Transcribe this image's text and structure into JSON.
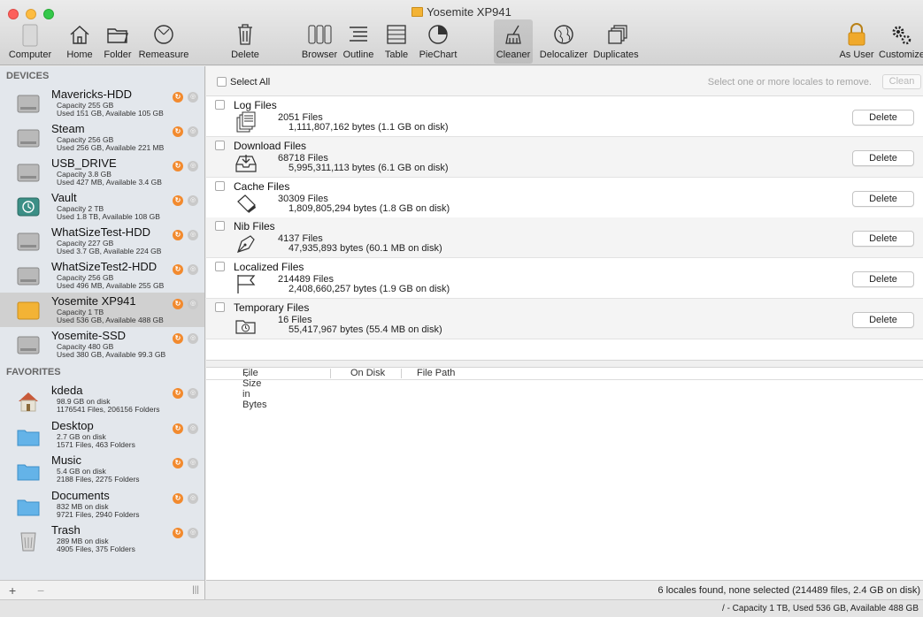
{
  "window": {
    "title": "Yosemite XP941"
  },
  "toolbar": [
    {
      "label": "Computer",
      "icon": "computer-icon"
    },
    {
      "label": "Home",
      "icon": "home-icon"
    },
    {
      "label": "Folder",
      "icon": "folder-icon"
    },
    {
      "label": "Remeasure",
      "icon": "remeasure-icon"
    },
    {
      "label": "Delete",
      "icon": "trash-icon"
    },
    {
      "label": "Browser",
      "icon": "browser-icon"
    },
    {
      "label": "Outline",
      "icon": "outline-icon"
    },
    {
      "label": "Table",
      "icon": "table-icon"
    },
    {
      "label": "PieChart",
      "icon": "piechart-icon"
    },
    {
      "label": "Cleaner",
      "icon": "broom-icon"
    },
    {
      "label": "Delocalizer",
      "icon": "globe-icon"
    },
    {
      "label": "Duplicates",
      "icon": "duplicates-icon"
    },
    {
      "label": "As User",
      "icon": "lock-icon"
    },
    {
      "label": "Customize",
      "icon": "gears-icon"
    }
  ],
  "sidebar": {
    "devices_header": "DEVICES",
    "favorites_header": "FAVORITES",
    "devices": [
      {
        "name": "Mavericks-HDD",
        "line1": "Capacity 255 GB",
        "line2": "Used 151 GB, Available 105 GB",
        "kind": "hdd"
      },
      {
        "name": "Steam",
        "line1": "Capacity 256 GB",
        "line2": "Used 256 GB, Available 221 MB",
        "kind": "hdd"
      },
      {
        "name": "USB_DRIVE",
        "line1": "Capacity 3.8 GB",
        "line2": "Used 427 MB, Available 3.4 GB",
        "kind": "hdd"
      },
      {
        "name": "Vault",
        "line1": "Capacity 2 TB",
        "line2": "Used 1.8 TB, Available 108 GB",
        "kind": "timemachine"
      },
      {
        "name": "WhatSizeTest-HDD",
        "line1": "Capacity 227 GB",
        "line2": "Used 3.7 GB, Available 224 GB",
        "kind": "hdd"
      },
      {
        "name": "WhatSizeTest2-HDD",
        "line1": "Capacity 256 GB",
        "line2": "Used 496 MB, Available 255 GB",
        "kind": "hdd"
      },
      {
        "name": "Yosemite XP941",
        "line1": "Capacity 1 TB",
        "line2": "Used 536 GB, Available 488 GB",
        "kind": "ssd",
        "selected": true
      },
      {
        "name": "Yosemite-SSD",
        "line1": "Capacity 480 GB",
        "line2": "Used 380 GB, Available 99.3 GB",
        "kind": "hdd"
      }
    ],
    "favorites": [
      {
        "name": "kdeda",
        "line1": "98.9 GB on disk",
        "line2": "1176541 Files, 206156 Folders",
        "kind": "home"
      },
      {
        "name": "Desktop",
        "line1": "2.7 GB on disk",
        "line2": "1571 Files, 463 Folders",
        "kind": "folder"
      },
      {
        "name": "Music",
        "line1": "5.4 GB on disk",
        "line2": "2188 Files, 2275 Folders",
        "kind": "folder"
      },
      {
        "name": "Documents",
        "line1": "832 MB on disk",
        "line2": "9721 Files, 2940 Folders",
        "kind": "folder"
      },
      {
        "name": "Trash",
        "line1": "289 MB on disk",
        "line2": "4905 Files, 375 Folders",
        "kind": "trash"
      }
    ],
    "add_label": "+",
    "remove_label": "−",
    "grip_label": "|||"
  },
  "main": {
    "select_all": "Select All",
    "hint": "Select one or more locales to remove.",
    "clean_label": "Clean",
    "categories": [
      {
        "title": "Log Files",
        "count": "2051 Files",
        "bytes": "1,111,807,162 bytes (1.1 GB on disk)",
        "icon": "log-icon",
        "delete": "Delete"
      },
      {
        "title": "Download Files",
        "count": "68718 Files",
        "bytes": "5,995,311,113 bytes (6.1 GB on disk)",
        "icon": "download-icon",
        "delete": "Delete"
      },
      {
        "title": "Cache Files",
        "count": "30309 Files",
        "bytes": "1,809,805,294 bytes (1.8 GB on disk)",
        "icon": "cache-icon",
        "delete": "Delete"
      },
      {
        "title": "Nib Files",
        "count": "4137 Files",
        "bytes": "47,935,893 bytes (60.1 MB on disk)",
        "icon": "nib-icon",
        "delete": "Delete"
      },
      {
        "title": "Localized Files",
        "count": "214489 Files",
        "bytes": "2,408,660,257 bytes (1.9 GB on disk)",
        "icon": "flag-icon",
        "delete": "Delete"
      },
      {
        "title": "Temporary Files",
        "count": "16 Files",
        "bytes": "55,417,967 bytes (55.4 MB on disk)",
        "icon": "temp-icon",
        "delete": "Delete"
      }
    ],
    "columns": [
      "File Size in Bytes",
      "On Disk",
      "File Path"
    ]
  },
  "status": {
    "main": "6 locales found, none selected (214489 files, 2.4 GB on disk)",
    "bottom": "/ - Capacity 1 TB, Used 536 GB, Available 488 GB"
  },
  "colors": {
    "orange": "#f28a2e",
    "sidebar": "#e3e7ec",
    "selected": "#d0d0d0"
  }
}
